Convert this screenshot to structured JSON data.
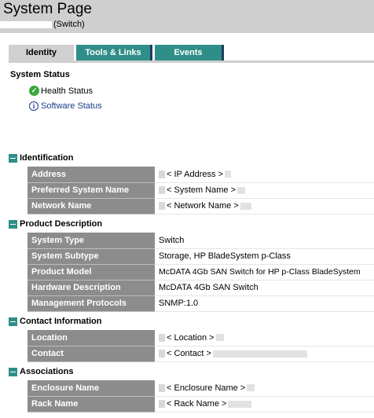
{
  "header": {
    "title": "System Page",
    "subtitle": "(Switch)"
  },
  "tabs": [
    {
      "label": "Identity",
      "active": true
    },
    {
      "label": "Tools & Links",
      "active": false
    },
    {
      "label": "Events",
      "active": false
    }
  ],
  "system_status": {
    "title": "System Status",
    "health": "Health Status",
    "software": "Software Status"
  },
  "identification": {
    "title": "Identification",
    "rows": [
      {
        "label": "Address",
        "value": "< IP Address >"
      },
      {
        "label": "Preferred System Name",
        "value": "< System Name >"
      },
      {
        "label": "Network Name",
        "value": "< Network Name >"
      }
    ]
  },
  "product": {
    "title": "Product Description",
    "rows": [
      {
        "label": "System Type",
        "value": "Switch"
      },
      {
        "label": "System Subtype",
        "value": "Storage, HP BladeSystem p-Class"
      },
      {
        "label": "Product Model",
        "value": "McDATA 4Gb SAN Switch for HP p-Class BladeSystem"
      },
      {
        "label": "Hardware Description",
        "value": "McDATA 4Gb SAN Switch"
      },
      {
        "label": "Management Protocols",
        "value": "SNMP:1.0"
      }
    ]
  },
  "contact": {
    "title": "Contact Information",
    "rows": [
      {
        "label": "Location",
        "value": "< Location >"
      },
      {
        "label": "Contact",
        "value": "< Contact >"
      }
    ]
  },
  "associations": {
    "title": "Associations",
    "rows": [
      {
        "label": "Enclosure Name",
        "value": "< Enclosure Name >"
      },
      {
        "label": "Rack Name",
        "value": "< Rack Name >"
      }
    ]
  },
  "colors": {
    "header_bg": "#cfcfcf",
    "tab_active": "#d0d0d0",
    "tab_inactive": "#2f8f88",
    "label_bg": "#8c8c8c",
    "icon_teal": "#2f8f88",
    "link_blue": "#1a3b8a"
  }
}
